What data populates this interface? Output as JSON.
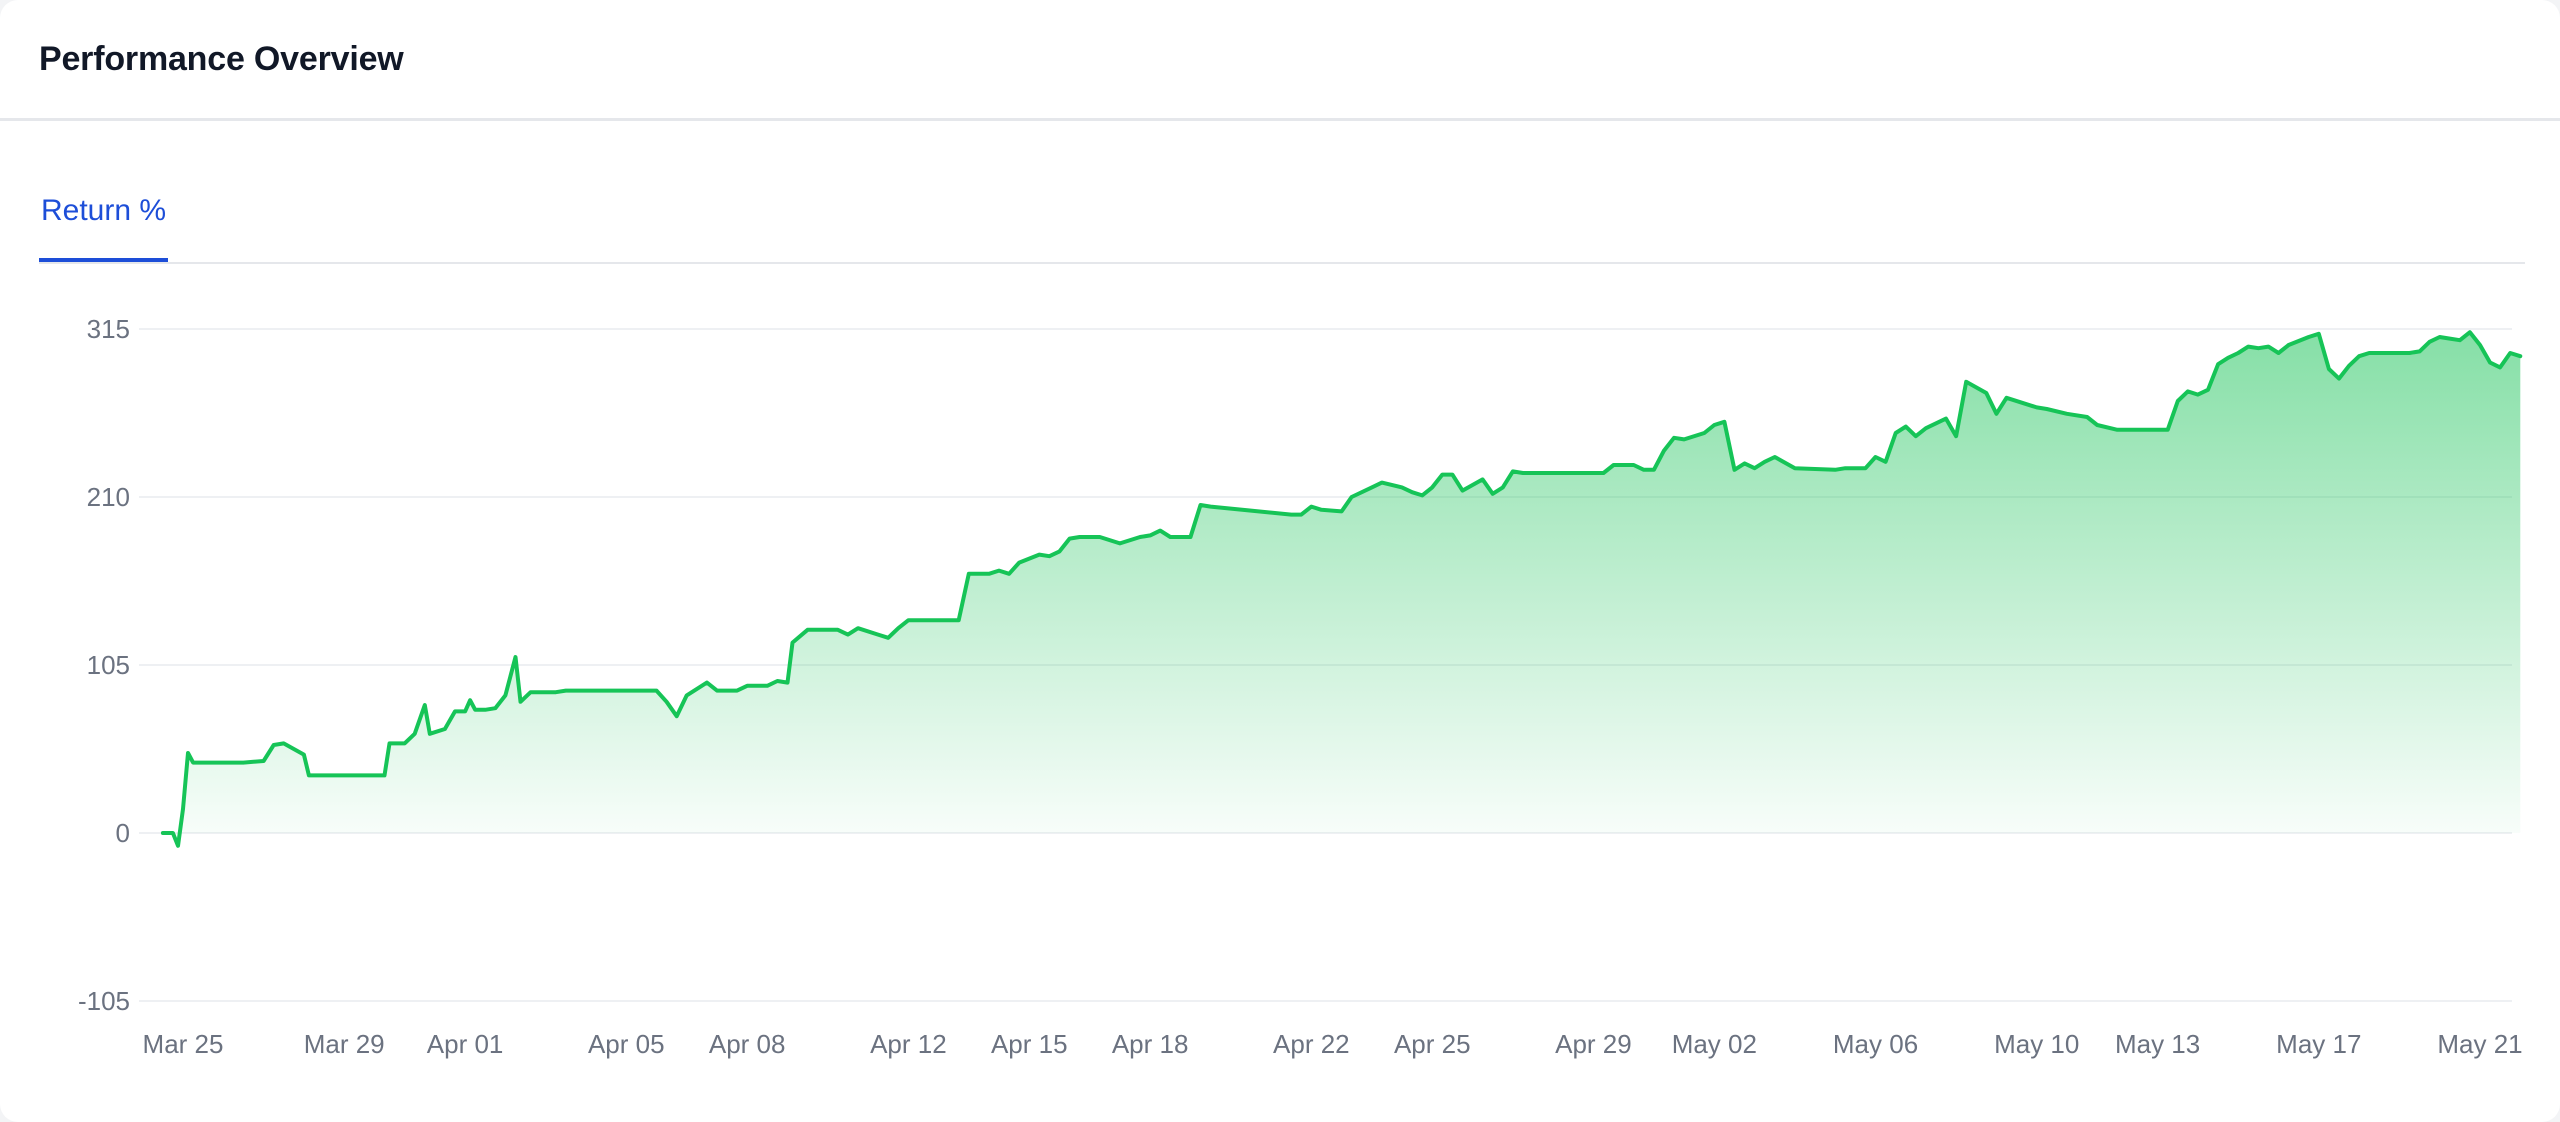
{
  "card": {
    "title": "Performance Overview"
  },
  "tabs": [
    {
      "label": "Return %",
      "active": true
    }
  ],
  "colors": {
    "line": "#16c457",
    "fill": "#22c55e",
    "tab_active": "#1d4ed8",
    "grid": "#eef0f3",
    "tick_text": "#6b7280"
  },
  "chart_data": {
    "type": "area",
    "title": "",
    "xlabel": "",
    "ylabel": "",
    "ylim": [
      -105,
      315
    ],
    "yticks": [
      315,
      210,
      105,
      0,
      -105
    ],
    "grid": true,
    "x_tick_labels": [
      "Mar 25",
      "Mar 29",
      "Apr 01",
      "Apr 05",
      "Apr 08",
      "Apr 12",
      "Apr 15",
      "Apr 18",
      "Apr 22",
      "Apr 25",
      "Apr 29",
      "May 02",
      "May 06",
      "May 10",
      "May 13",
      "May 17",
      "May 21"
    ],
    "x_tick_dates": [
      "2024-03-25",
      "2024-03-29",
      "2024-04-01",
      "2024-04-05",
      "2024-04-08",
      "2024-04-12",
      "2024-04-15",
      "2024-04-18",
      "2024-04-22",
      "2024-04-25",
      "2024-04-29",
      "2024-05-02",
      "2024-05-06",
      "2024-05-10",
      "2024-05-13",
      "2024-05-17",
      "2024-05-21"
    ],
    "series": [
      {
        "points": [
          [
            "2024-03-24 12:00",
            0
          ],
          [
            "2024-03-24 18:00",
            0
          ],
          [
            "2024-03-24 21:00",
            -8
          ],
          [
            "2024-03-25 00:00",
            15
          ],
          [
            "2024-03-25 03:00",
            50
          ],
          [
            "2024-03-25 06:00",
            44
          ],
          [
            "2024-03-26 00:00",
            44
          ],
          [
            "2024-03-26 12:00",
            44
          ],
          [
            "2024-03-27 00:00",
            45
          ],
          [
            "2024-03-27 06:00",
            55
          ],
          [
            "2024-03-27 12:00",
            56
          ],
          [
            "2024-03-28 00:00",
            49
          ],
          [
            "2024-03-28 03:00",
            36
          ],
          [
            "2024-03-29 00:00",
            36
          ],
          [
            "2024-03-30 00:00",
            36
          ],
          [
            "2024-03-30 03:00",
            56
          ],
          [
            "2024-03-30 12:00",
            56
          ],
          [
            "2024-03-30 18:00",
            62
          ],
          [
            "2024-03-31 00:00",
            80
          ],
          [
            "2024-03-31 03:00",
            62
          ],
          [
            "2024-03-31 12:00",
            65
          ],
          [
            "2024-03-31 18:00",
            76
          ],
          [
            "2024-04-01 00:00",
            76
          ],
          [
            "2024-04-01 03:00",
            83
          ],
          [
            "2024-04-01 06:00",
            77
          ],
          [
            "2024-04-01 12:00",
            77
          ],
          [
            "2024-04-01 18:00",
            78
          ],
          [
            "2024-04-02 00:00",
            86
          ],
          [
            "2024-04-02 06:00",
            110
          ],
          [
            "2024-04-02 09:00",
            82
          ],
          [
            "2024-04-02 15:00",
            88
          ],
          [
            "2024-04-03 06:00",
            88
          ],
          [
            "2024-04-03 12:00",
            89
          ],
          [
            "2024-04-05 18:00",
            89
          ],
          [
            "2024-04-06 00:00",
            82
          ],
          [
            "2024-04-06 06:00",
            73
          ],
          [
            "2024-04-06 12:00",
            86
          ],
          [
            "2024-04-07 00:00",
            94
          ],
          [
            "2024-04-07 06:00",
            89
          ],
          [
            "2024-04-07 18:00",
            89
          ],
          [
            "2024-04-08 00:00",
            92
          ],
          [
            "2024-04-08 12:00",
            92
          ],
          [
            "2024-04-08 18:00",
            95
          ],
          [
            "2024-04-09 00:00",
            94
          ],
          [
            "2024-04-09 03:00",
            119
          ],
          [
            "2024-04-09 12:00",
            127
          ],
          [
            "2024-04-09 18:00",
            127
          ],
          [
            "2024-04-10 06:00",
            127
          ],
          [
            "2024-04-10 12:00",
            124
          ],
          [
            "2024-04-10 18:00",
            128
          ],
          [
            "2024-04-11 06:00",
            124
          ],
          [
            "2024-04-11 12:00",
            122
          ],
          [
            "2024-04-11 18:00",
            128
          ],
          [
            "2024-04-12 00:00",
            133
          ],
          [
            "2024-04-13 00:00",
            133
          ],
          [
            "2024-04-13 06:00",
            133
          ],
          [
            "2024-04-13 12:00",
            162
          ],
          [
            "2024-04-14 00:00",
            162
          ],
          [
            "2024-04-14 06:00",
            164
          ],
          [
            "2024-04-14 12:00",
            162
          ],
          [
            "2024-04-14 18:00",
            169
          ],
          [
            "2024-04-15 06:00",
            174
          ],
          [
            "2024-04-15 12:00",
            173
          ],
          [
            "2024-04-15 18:00",
            176
          ],
          [
            "2024-04-16 00:00",
            184
          ],
          [
            "2024-04-16 06:00",
            185
          ],
          [
            "2024-04-16 18:00",
            185
          ],
          [
            "2024-04-17 06:00",
            181
          ],
          [
            "2024-04-17 18:00",
            185
          ],
          [
            "2024-04-18 00:00",
            186
          ],
          [
            "2024-04-18 06:00",
            189
          ],
          [
            "2024-04-18 12:00",
            185
          ],
          [
            "2024-04-19 00:00",
            185
          ],
          [
            "2024-04-19 06:00",
            205
          ],
          [
            "2024-04-19 12:00",
            204
          ],
          [
            "2024-04-21 12:00",
            199
          ],
          [
            "2024-04-21 18:00",
            199
          ],
          [
            "2024-04-22 00:00",
            204
          ],
          [
            "2024-04-22 06:00",
            202
          ],
          [
            "2024-04-22 18:00",
            201
          ],
          [
            "2024-04-23 00:00",
            210
          ],
          [
            "2024-04-23 12:00",
            216
          ],
          [
            "2024-04-23 18:00",
            219
          ],
          [
            "2024-04-24 06:00",
            216
          ],
          [
            "2024-04-24 12:00",
            213
          ],
          [
            "2024-04-24 18:00",
            211
          ],
          [
            "2024-04-25 00:00",
            216
          ],
          [
            "2024-04-25 06:00",
            224
          ],
          [
            "2024-04-25 12:00",
            224
          ],
          [
            "2024-04-25 18:00",
            214
          ],
          [
            "2024-04-26 06:00",
            221
          ],
          [
            "2024-04-26 12:00",
            212
          ],
          [
            "2024-04-26 18:00",
            216
          ],
          [
            "2024-04-27 00:00",
            226
          ],
          [
            "2024-04-27 06:00",
            225
          ],
          [
            "2024-04-29 06:00",
            225
          ],
          [
            "2024-04-29 12:00",
            230
          ],
          [
            "2024-04-30 00:00",
            230
          ],
          [
            "2024-04-30 06:00",
            227
          ],
          [
            "2024-04-30 12:00",
            227
          ],
          [
            "2024-04-30 18:00",
            239
          ],
          [
            "2024-05-01 00:00",
            247
          ],
          [
            "2024-05-01 06:00",
            246
          ],
          [
            "2024-05-01 18:00",
            250
          ],
          [
            "2024-05-02 00:00",
            255
          ],
          [
            "2024-05-02 06:00",
            257
          ],
          [
            "2024-05-02 12:00",
            227
          ],
          [
            "2024-05-02 18:00",
            231
          ],
          [
            "2024-05-03 00:00",
            228
          ],
          [
            "2024-05-03 06:00",
            232
          ],
          [
            "2024-05-03 12:00",
            235
          ],
          [
            "2024-05-04 00:00",
            228
          ],
          [
            "2024-05-05 00:00",
            227
          ],
          [
            "2024-05-05 06:00",
            228
          ],
          [
            "2024-05-05 18:00",
            228
          ],
          [
            "2024-05-06 00:00",
            235
          ],
          [
            "2024-05-06 06:00",
            232
          ],
          [
            "2024-05-06 12:00",
            250
          ],
          [
            "2024-05-06 18:00",
            254
          ],
          [
            "2024-05-07 00:00",
            248
          ],
          [
            "2024-05-07 06:00",
            253
          ],
          [
            "2024-05-07 18:00",
            259
          ],
          [
            "2024-05-08 00:00",
            248
          ],
          [
            "2024-05-08 06:00",
            282
          ],
          [
            "2024-05-08 18:00",
            275
          ],
          [
            "2024-05-09 00:00",
            262
          ],
          [
            "2024-05-09 06:00",
            272
          ],
          [
            "2024-05-10 00:00",
            266
          ],
          [
            "2024-05-10 06:00",
            265
          ],
          [
            "2024-05-10 18:00",
            262
          ],
          [
            "2024-05-11 06:00",
            260
          ],
          [
            "2024-05-11 12:00",
            255
          ],
          [
            "2024-05-12 00:00",
            252
          ],
          [
            "2024-05-13 06:00",
            252
          ],
          [
            "2024-05-13 12:00",
            270
          ],
          [
            "2024-05-13 18:00",
            276
          ],
          [
            "2024-05-14 00:00",
            274
          ],
          [
            "2024-05-14 06:00",
            277
          ],
          [
            "2024-05-14 12:00",
            293
          ],
          [
            "2024-05-14 18:00",
            297
          ],
          [
            "2024-05-15 00:00",
            300
          ],
          [
            "2024-05-15 06:00",
            304
          ],
          [
            "2024-05-15 12:00",
            303
          ],
          [
            "2024-05-15 18:00",
            304
          ],
          [
            "2024-05-16 00:00",
            300
          ],
          [
            "2024-05-16 06:00",
            305
          ],
          [
            "2024-05-16 18:00",
            310
          ],
          [
            "2024-05-17 00:00",
            312
          ],
          [
            "2024-05-17 06:00",
            290
          ],
          [
            "2024-05-17 12:00",
            284
          ],
          [
            "2024-05-17 18:00",
            292
          ],
          [
            "2024-05-18 00:00",
            298
          ],
          [
            "2024-05-18 06:00",
            300
          ],
          [
            "2024-05-18 18:00",
            300
          ],
          [
            "2024-05-19 06:00",
            300
          ],
          [
            "2024-05-19 12:00",
            301
          ],
          [
            "2024-05-19 18:00",
            307
          ],
          [
            "2024-05-20 00:00",
            310
          ],
          [
            "2024-05-20 06:00",
            309
          ],
          [
            "2024-05-20 12:00",
            308
          ],
          [
            "2024-05-20 18:00",
            313
          ],
          [
            "2024-05-21 00:00",
            305
          ],
          [
            "2024-05-21 06:00",
            294
          ],
          [
            "2024-05-21 12:00",
            291
          ],
          [
            "2024-05-21 18:00",
            300
          ],
          [
            "2024-05-22 00:00",
            298
          ]
        ]
      }
    ]
  }
}
